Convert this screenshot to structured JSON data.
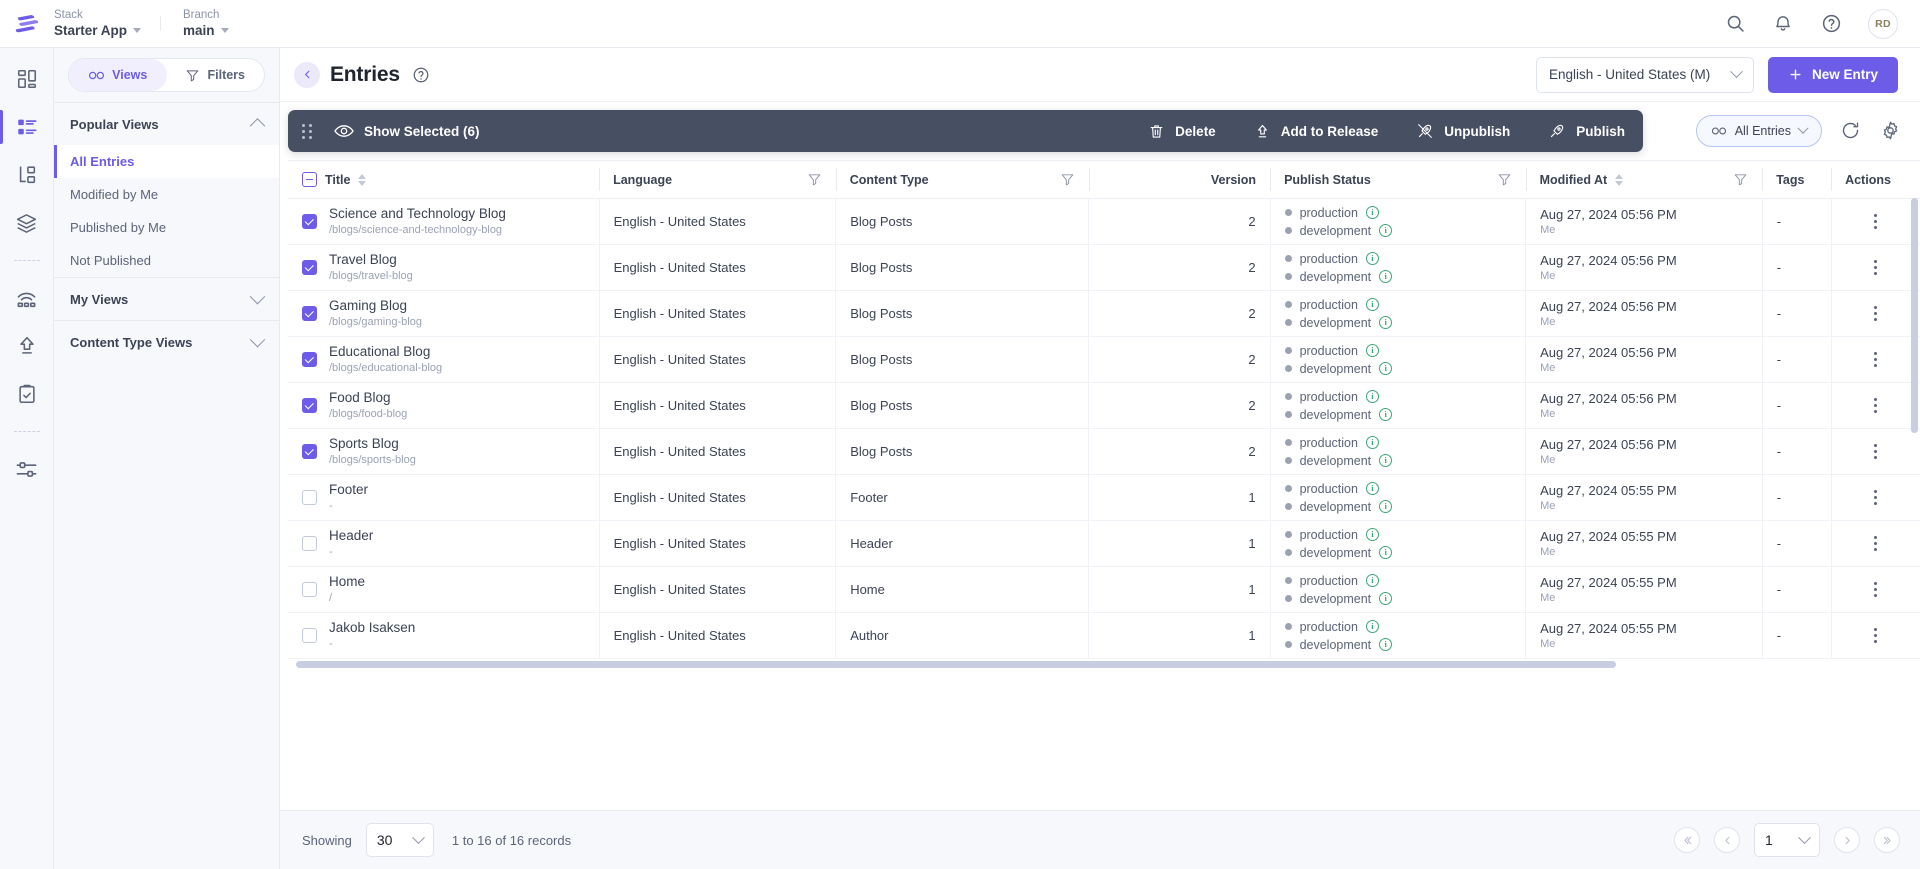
{
  "topbar": {
    "logo_icon": "contentstack-logo-icon",
    "stack": {
      "label": "Stack",
      "value": "Starter App"
    },
    "branch": {
      "label": "Branch",
      "value": "main"
    },
    "icons": [
      "search-icon",
      "notification-bell-icon",
      "help-circle-icon"
    ],
    "avatar_initials": "RD"
  },
  "rail": {
    "items": [
      {
        "name": "dashboard-icon",
        "active": false
      },
      {
        "name": "entries-icon",
        "active": true
      },
      {
        "name": "content-models-icon",
        "active": false
      },
      {
        "name": "assets-stack-icon",
        "active": false
      },
      {
        "name": "live-preview-icon",
        "active": false
      },
      {
        "name": "publish-queue-icon",
        "active": false
      },
      {
        "name": "audit-log-icon",
        "active": false
      },
      {
        "name": "settings-sliders-icon",
        "active": false
      }
    ]
  },
  "views_panel": {
    "views_tab": "Views",
    "filters_tab": "Filters",
    "sections": [
      {
        "title": "Popular Views",
        "expanded": true,
        "items": [
          {
            "label": "All Entries",
            "active": true
          },
          {
            "label": "Modified by Me",
            "active": false
          },
          {
            "label": "Published by Me",
            "active": false
          },
          {
            "label": "Not Published",
            "active": false
          }
        ]
      },
      {
        "title": "My Views",
        "expanded": false,
        "items": []
      },
      {
        "title": "Content Type Views",
        "expanded": false,
        "items": []
      }
    ]
  },
  "header": {
    "collapse_icon": "chevron-left-icon",
    "title": "Entries",
    "help_icon": "help-circle-icon",
    "locale": "English - United States (M)",
    "new_entry_label": "New Entry"
  },
  "bulk_bar": {
    "grip_icon": "drag-handle-icon",
    "show_selected_label": "Show Selected (6)",
    "actions": [
      {
        "label": "Delete",
        "icon": "trash-icon"
      },
      {
        "label": "Add to Release",
        "icon": "add-to-release-icon"
      },
      {
        "label": "Unpublish",
        "icon": "unpublish-icon"
      },
      {
        "label": "Publish",
        "icon": "rocket-publish-icon"
      }
    ]
  },
  "toolbar_right": {
    "view_pill": "All Entries",
    "refresh_icon": "refresh-icon",
    "settings_icon": "gear-icon"
  },
  "table": {
    "columns": [
      {
        "key": "check",
        "label": ""
      },
      {
        "key": "title",
        "label": "Title",
        "sortable": true
      },
      {
        "key": "language",
        "label": "Language",
        "filterable": true
      },
      {
        "key": "content_type",
        "label": "Content Type",
        "filterable": true
      },
      {
        "key": "version",
        "label": "Version"
      },
      {
        "key": "publish_status",
        "label": "Publish Status",
        "filterable": true
      },
      {
        "key": "modified_at",
        "label": "Modified At",
        "sortable": true,
        "filterable": true
      },
      {
        "key": "tags",
        "label": "Tags"
      },
      {
        "key": "actions",
        "label": "Actions"
      }
    ],
    "header_checkbox_state": "indeterminate",
    "rows": [
      {
        "checked": true,
        "title": "Science and Technology Blog",
        "url": "/blogs/science-and-technology-blog",
        "language": "English - United States",
        "content_type": "Blog Posts",
        "version": "2",
        "environments": [
          "production",
          "development"
        ],
        "modified_at": "Aug 27, 2024 05:56 PM",
        "modified_by": "Me",
        "tags": "-"
      },
      {
        "checked": true,
        "title": "Travel Blog",
        "url": "/blogs/travel-blog",
        "language": "English - United States",
        "content_type": "Blog Posts",
        "version": "2",
        "environments": [
          "production",
          "development"
        ],
        "modified_at": "Aug 27, 2024 05:56 PM",
        "modified_by": "Me",
        "tags": "-"
      },
      {
        "checked": true,
        "title": "Gaming Blog",
        "url": "/blogs/gaming-blog",
        "language": "English - United States",
        "content_type": "Blog Posts",
        "version": "2",
        "environments": [
          "production",
          "development"
        ],
        "modified_at": "Aug 27, 2024 05:56 PM",
        "modified_by": "Me",
        "tags": "-"
      },
      {
        "checked": true,
        "title": "Educational Blog",
        "url": "/blogs/educational-blog",
        "language": "English - United States",
        "content_type": "Blog Posts",
        "version": "2",
        "environments": [
          "production",
          "development"
        ],
        "modified_at": "Aug 27, 2024 05:56 PM",
        "modified_by": "Me",
        "tags": "-"
      },
      {
        "checked": true,
        "title": "Food Blog",
        "url": "/blogs/food-blog",
        "language": "English - United States",
        "content_type": "Blog Posts",
        "version": "2",
        "environments": [
          "production",
          "development"
        ],
        "modified_at": "Aug 27, 2024 05:56 PM",
        "modified_by": "Me",
        "tags": "-"
      },
      {
        "checked": true,
        "title": "Sports Blog",
        "url": "/blogs/sports-blog",
        "language": "English - United States",
        "content_type": "Blog Posts",
        "version": "2",
        "environments": [
          "production",
          "development"
        ],
        "modified_at": "Aug 27, 2024 05:56 PM",
        "modified_by": "Me",
        "tags": "-"
      },
      {
        "checked": false,
        "title": "Footer",
        "url": "-",
        "language": "English - United States",
        "content_type": "Footer",
        "version": "1",
        "environments": [
          "production",
          "development"
        ],
        "modified_at": "Aug 27, 2024 05:55 PM",
        "modified_by": "Me",
        "tags": "-"
      },
      {
        "checked": false,
        "title": "Header",
        "url": "-",
        "language": "English - United States",
        "content_type": "Header",
        "version": "1",
        "environments": [
          "production",
          "development"
        ],
        "modified_at": "Aug 27, 2024 05:55 PM",
        "modified_by": "Me",
        "tags": "-"
      },
      {
        "checked": false,
        "title": "Home",
        "url": "/",
        "language": "English - United States",
        "content_type": "Home",
        "version": "1",
        "environments": [
          "production",
          "development"
        ],
        "modified_at": "Aug 27, 2024 05:55 PM",
        "modified_by": "Me",
        "tags": "-"
      },
      {
        "checked": false,
        "title": "Jakob Isaksen",
        "url": "-",
        "language": "English - United States",
        "content_type": "Author",
        "version": "1",
        "environments": [
          "production",
          "development"
        ],
        "modified_at": "Aug 27, 2024 05:55 PM",
        "modified_by": "Me",
        "tags": "-"
      }
    ]
  },
  "footer": {
    "showing_label": "Showing",
    "page_size": "30",
    "records_text": "1 to 16 of 16 records",
    "current_page": "1",
    "first_icon": "double-chevron-left-icon",
    "prev_icon": "chevron-left-icon",
    "next_icon": "chevron-right-icon",
    "last_icon": "double-chevron-right-icon"
  },
  "colors": {
    "accent": "#6c5ce7",
    "bulkbar_bg": "#474f63",
    "panel_bg": "#f7f8fc",
    "text": "#3b4354",
    "muted": "#9aa2b4",
    "env_dot": "#9aa2b4",
    "info_green": "#3ba776"
  }
}
